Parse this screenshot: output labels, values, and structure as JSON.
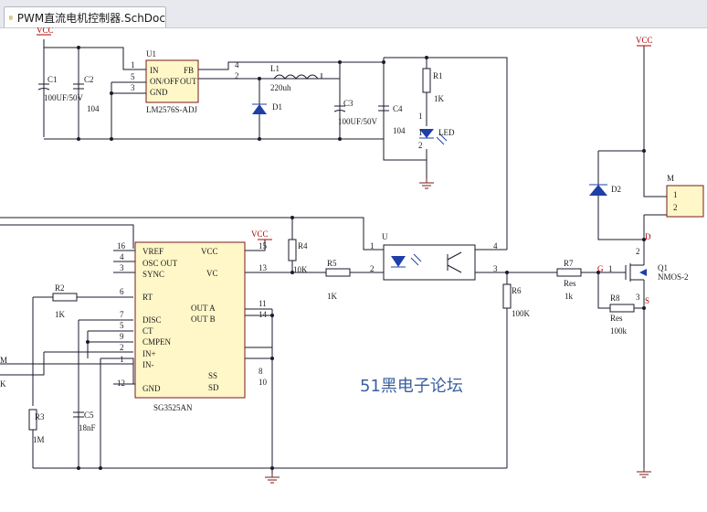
{
  "tab": {
    "title": "PWM直流电机控制器.SchDoc"
  },
  "watermark": "51黑电子论坛",
  "power": {
    "vcc_top_left": "VCC",
    "vcc_right": "VCC",
    "vcc_mid": "VCC"
  },
  "U1": {
    "ref": "U1",
    "part": "LM2576S-ADJ",
    "pins": {
      "in": "IN",
      "onoff": "ON/OFF",
      "gnd": "GND",
      "fb": "FB",
      "out": "OUT"
    },
    "pin_numbers": {
      "p1": "1",
      "p5": "5",
      "p3": "3",
      "p4": "4",
      "p2": "2"
    }
  },
  "C1": {
    "ref": "C1",
    "value": "100UF/50V"
  },
  "C2": {
    "ref": "C2",
    "value": "104"
  },
  "L1": {
    "ref": "L1",
    "value": "220uh"
  },
  "D1": {
    "ref": "D1"
  },
  "C3": {
    "ref": "C3",
    "value": "100UF/50V"
  },
  "C4": {
    "ref": "C4",
    "value": "104"
  },
  "R1": {
    "ref": "R1",
    "value": "1K",
    "pin1": "1",
    "pin2": "2"
  },
  "LED": {
    "ref": "LED",
    "pin1": "1",
    "pin2": "2"
  },
  "U": {
    "ref": "U",
    "pin1": "1",
    "pin2": "2",
    "pin3": "3",
    "pin4": "4"
  },
  "R4": {
    "ref": "R4",
    "value": "10K"
  },
  "R5": {
    "ref": "R5",
    "value": "1K"
  },
  "R6": {
    "ref": "R6",
    "value": "100K"
  },
  "R7": {
    "ref": "R7",
    "value": "Res",
    "value2": "1k"
  },
  "R8": {
    "ref": "R8",
    "value": "Res",
    "value2": "100k"
  },
  "Q1": {
    "ref": "Q1",
    "part": "NMOS-2",
    "g": "G",
    "d": "D",
    "s": "S",
    "pin1": "1",
    "pin2": "2",
    "pin3": "3"
  },
  "D2": {
    "ref": "D2"
  },
  "M": {
    "ref": "M",
    "pin1": "1",
    "pin2": "2"
  },
  "U2": {
    "part": "SG3525AN",
    "left_pins": [
      {
        "num": "16",
        "name": "VREF"
      },
      {
        "num": "4",
        "name": "OSC OUT"
      },
      {
        "num": "3",
        "name": "SYNC"
      },
      {
        "num": "6",
        "name": "RT"
      },
      {
        "num": "7",
        "name": "DISC"
      },
      {
        "num": "5",
        "name": "CT"
      },
      {
        "num": "9",
        "name": "CMPEN"
      },
      {
        "num": "2",
        "name": "IN+"
      },
      {
        "num": "1",
        "name": "IN-"
      },
      {
        "num": "12",
        "name": "GND"
      }
    ],
    "right_pins": [
      {
        "num": "15",
        "name": "VCC"
      },
      {
        "num": "13",
        "name": "VC"
      },
      {
        "num": "11",
        "name": "OUT A"
      },
      {
        "num": "14",
        "name": "OUT B"
      },
      {
        "num": "8",
        "name": "SS"
      },
      {
        "num": "10",
        "name": "SD"
      }
    ]
  },
  "R2": {
    "ref": "R2",
    "value": "1K"
  },
  "R3": {
    "ref": "R3",
    "value": "1M"
  },
  "C5": {
    "ref": "C5",
    "value": "18nF"
  },
  "edge": {
    "m": "M",
    "k": "K"
  }
}
